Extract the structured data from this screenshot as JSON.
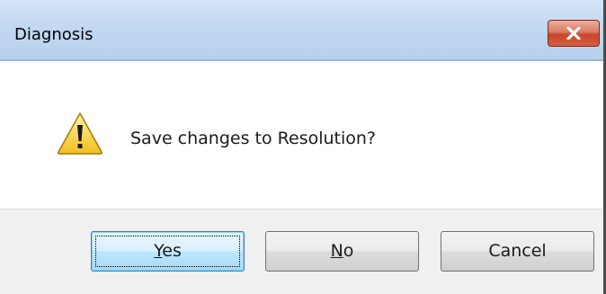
{
  "window": {
    "title": "Diagnosis",
    "close_icon": "close-icon"
  },
  "dialog": {
    "icon": "warning-icon",
    "message": "Save changes to Resolution?"
  },
  "buttons": {
    "yes": {
      "mnemonic": "Y",
      "rest": "es"
    },
    "no": {
      "mnemonic": "N",
      "rest": "o"
    },
    "cancel": {
      "label": "Cancel"
    }
  },
  "colors": {
    "titlebar": "#c3d8f1",
    "close_button": "#c7472c",
    "footer": "#f0f0f0",
    "default_button": "#bee6fd"
  }
}
